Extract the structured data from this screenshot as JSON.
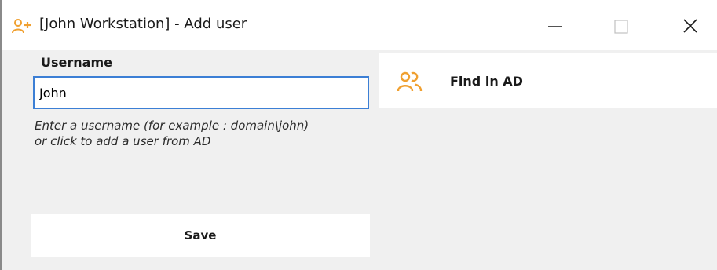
{
  "window": {
    "title": "[John Workstation] - Add user",
    "icon": "add-user-icon",
    "controls": [
      "minimize-icon",
      "maximize-icon",
      "close-icon"
    ]
  },
  "form": {
    "username_label": "Username",
    "username_value": "John",
    "hint_line1": "Enter a username (for example : domain\\john)",
    "hint_line2": "or click to add a user from AD",
    "save_label": "Save"
  },
  "find_panel": {
    "label": "Find in AD",
    "icon": "users-icon"
  },
  "colors": {
    "accent": "#f0a030",
    "input_border": "#3c7fd5",
    "background": "#f0f0f0"
  }
}
